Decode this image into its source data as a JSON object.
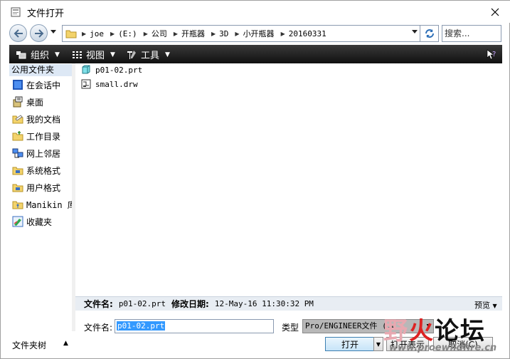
{
  "window": {
    "title": "文件打开",
    "close_glyph": "✕"
  },
  "nav": {
    "back_glyph": "←",
    "forward_glyph": "→",
    "path": [
      "joe",
      "(E:)",
      "公司",
      "开瓶器",
      "3D",
      "小开瓶器",
      "20160331"
    ],
    "search_placeholder": "搜索..."
  },
  "toolbar": {
    "organize": "组织",
    "view": "视图",
    "tools": "工具"
  },
  "sidebar": {
    "header": "公用文件夹",
    "items": [
      {
        "label": "在会话中",
        "icon": "session-icon"
      },
      {
        "label": "桌面",
        "icon": "desktop-icon"
      },
      {
        "label": "我的文档",
        "icon": "documents-icon"
      },
      {
        "label": "工作目录",
        "icon": "working-dir-icon"
      },
      {
        "label": "网上邻居",
        "icon": "network-icon"
      },
      {
        "label": "系统格式",
        "icon": "system-format-icon"
      },
      {
        "label": "用户格式",
        "icon": "user-format-icon"
      },
      {
        "label": "Manikin 库",
        "icon": "manikin-icon"
      },
      {
        "label": "收藏夹",
        "icon": "favorites-icon"
      }
    ]
  },
  "files": [
    {
      "name": "p01-02.prt",
      "icon": "part-file-icon"
    },
    {
      "name": "small.drw",
      "icon": "drawing-file-icon"
    }
  ],
  "info": {
    "filename_label": "文件名:",
    "filename_value": "p01-02.prt",
    "modified_label": "修改日期:",
    "modified_value": "12-May-16 11:30:32 PM",
    "preview_label": "预览"
  },
  "form": {
    "filename_label": "文件名:",
    "filename_value": "p01-02.prt",
    "type_label": "类型",
    "type_value": "Pro/ENGINEER文件 (.p"
  },
  "bottom": {
    "tree_label": "文件夹树",
    "open_label": "打开",
    "open_view_label": "打开表示",
    "cancel_label": "取消(C)"
  },
  "watermark": {
    "text_a": "野",
    "text_b": "火",
    "text_c": "论坛",
    "url": "www.proewildfire.cn"
  }
}
